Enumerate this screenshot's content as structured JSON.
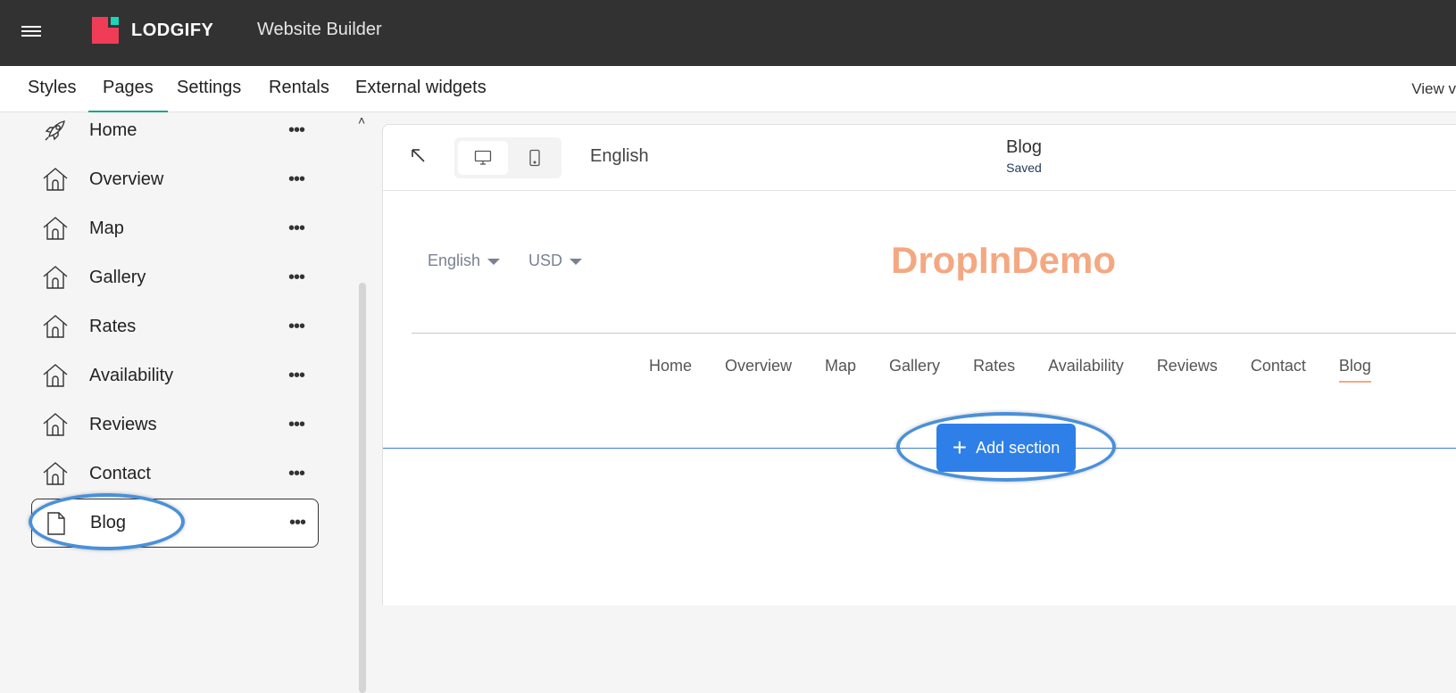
{
  "topbar": {
    "brand": "LODGIFY",
    "app_title": "Website Builder",
    "colors": {
      "background": "#323232",
      "brand_red": "#ef3d57",
      "brand_teal": "#18d6b9"
    }
  },
  "tabs": [
    {
      "label": "Styles"
    },
    {
      "label": "Pages",
      "active": true
    },
    {
      "label": "Settings"
    },
    {
      "label": "Rentals"
    },
    {
      "label": "External widgets"
    }
  ],
  "view_link": "View v",
  "sidebar": {
    "pages": [
      {
        "label": "Home",
        "icon": "rocket-icon",
        "more": "•••"
      },
      {
        "label": "Overview",
        "icon": "house-icon",
        "more": "•••"
      },
      {
        "label": "Map",
        "icon": "house-icon",
        "more": "•••"
      },
      {
        "label": "Gallery",
        "icon": "house-icon",
        "more": "•••"
      },
      {
        "label": "Rates",
        "icon": "house-icon",
        "more": "•••"
      },
      {
        "label": "Availability",
        "icon": "house-icon",
        "more": "•••"
      },
      {
        "label": "Reviews",
        "icon": "house-icon",
        "more": "•••"
      },
      {
        "label": "Contact",
        "icon": "house-icon",
        "more": "•••"
      },
      {
        "label": "Blog",
        "icon": "document-icon",
        "more": "•••",
        "selected": true
      }
    ]
  },
  "preview": {
    "language": "English",
    "doc_title": "Blog",
    "doc_status": "Saved",
    "site": {
      "language": "English",
      "currency": "USD",
      "brand": "DropInDemo",
      "brand_color": "#f4a882",
      "nav": [
        "Home",
        "Overview",
        "Map",
        "Gallery",
        "Rates",
        "Availability",
        "Reviews",
        "Contact",
        "Blog"
      ],
      "active_nav": "Blog"
    },
    "add_section_label": "Add section",
    "accent_color": "#2f7fe8"
  }
}
